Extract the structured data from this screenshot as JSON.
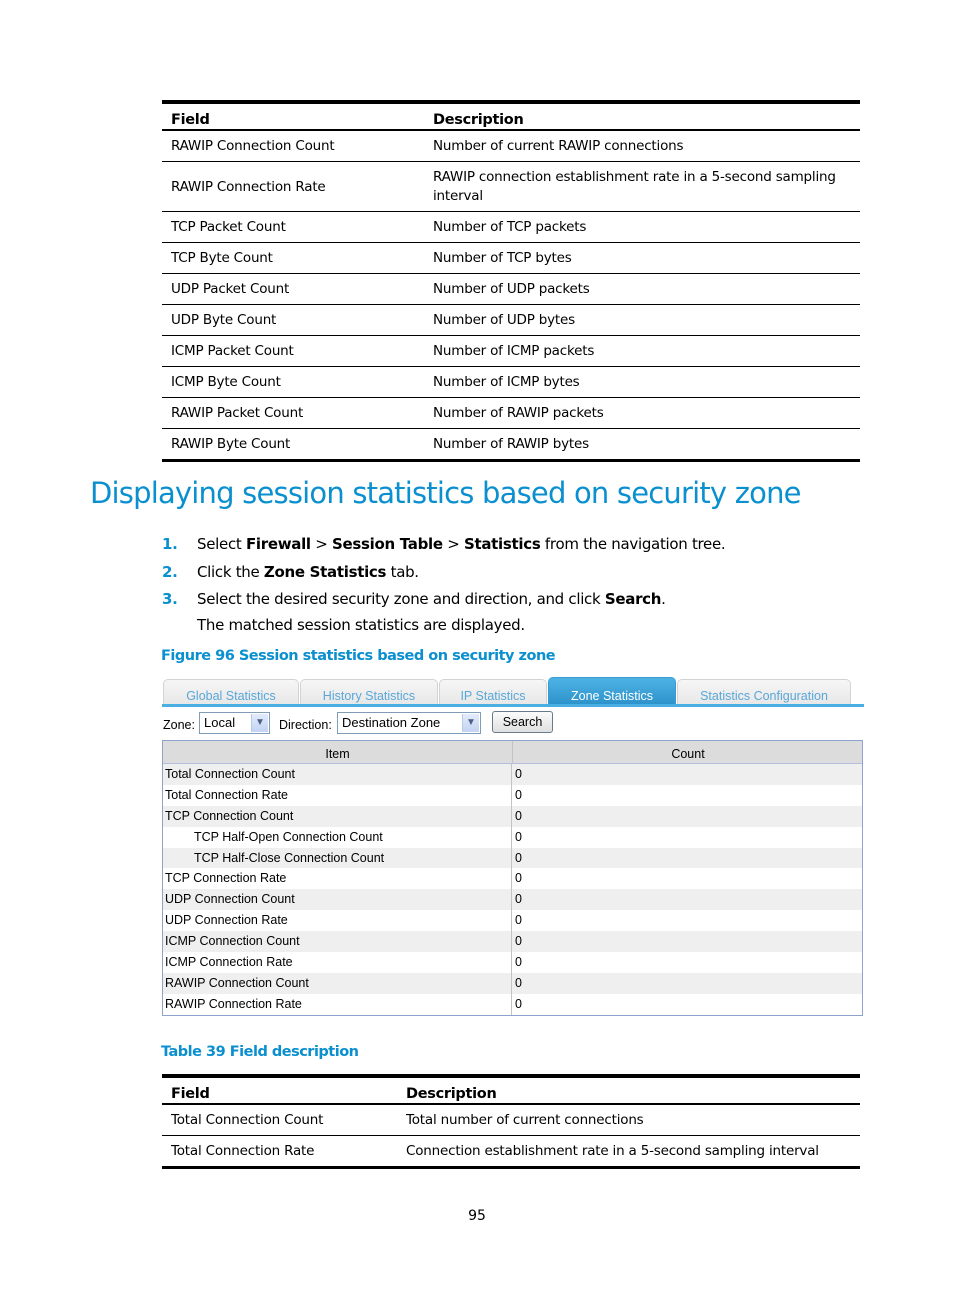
{
  "table_top": {
    "headers": [
      "Field",
      "Description"
    ],
    "rows": [
      {
        "field": "RAWIP Connection Count",
        "desc": "Number of current RAWIP connections"
      },
      {
        "field": "RAWIP Connection Rate",
        "desc": "RAWIP connection establishment rate in a 5-second sampling interval"
      },
      {
        "field": "TCP Packet Count",
        "desc": "Number of TCP packets"
      },
      {
        "field": "TCP Byte Count",
        "desc": "Number of TCP bytes"
      },
      {
        "field": "UDP Packet Count",
        "desc": "Number of UDP packets"
      },
      {
        "field": "UDP Byte Count",
        "desc": "Number of UDP bytes"
      },
      {
        "field": "ICMP Packet Count",
        "desc": "Number of ICMP packets"
      },
      {
        "field": "ICMP Byte Count",
        "desc": "Number of ICMP bytes"
      },
      {
        "field": "RAWIP Packet Count",
        "desc": "Number of RAWIP packets"
      },
      {
        "field": "RAWIP Byte Count",
        "desc": "Number of RAWIP bytes"
      }
    ]
  },
  "section": {
    "title": "Displaying session statistics based on security zone",
    "steps": [
      {
        "num": "1.",
        "parts": [
          [
            "Select ",
            false
          ],
          [
            "Firewall",
            true
          ],
          [
            " > ",
            false
          ],
          [
            "Session Table",
            true
          ],
          [
            " > ",
            false
          ],
          [
            "Statistics",
            true
          ],
          [
            " from the navigation tree.",
            false
          ]
        ]
      },
      {
        "num": "2.",
        "parts": [
          [
            "Click the ",
            false
          ],
          [
            "Zone Statistics",
            true
          ],
          [
            " tab.",
            false
          ]
        ]
      },
      {
        "num": "3.",
        "parts": [
          [
            "Select the desired security zone and direction, and click ",
            false
          ],
          [
            "Search",
            true
          ],
          [
            ".",
            false
          ]
        ]
      }
    ],
    "note": "The matched session statistics are displayed.",
    "figure_caption": "Figure 96 Session statistics based on security zone"
  },
  "ui": {
    "tabs": [
      {
        "label": "Global Statistics",
        "active": false
      },
      {
        "label": "History Statistics",
        "active": false
      },
      {
        "label": "IP Statistics",
        "active": false
      },
      {
        "label": "Zone Statistics",
        "active": true
      },
      {
        "label": "Statistics Configuration",
        "active": false
      }
    ],
    "zone_label": "Zone:",
    "zone_value": "Local",
    "direction_label": "Direction:",
    "direction_value": "Destination Zone",
    "search_label": "Search",
    "grid_headers": {
      "item": "Item",
      "count": "Count"
    },
    "grid_rows": [
      {
        "item": "Total Connection Count",
        "count": "0",
        "indent": false
      },
      {
        "item": "Total Connection Rate",
        "count": "0",
        "indent": false
      },
      {
        "item": "TCP Connection Count",
        "count": "0",
        "indent": false
      },
      {
        "item": "TCP Half-Open Connection Count",
        "count": "0",
        "indent": true
      },
      {
        "item": "TCP Half-Close Connection Count",
        "count": "0",
        "indent": true
      },
      {
        "item": "TCP Connection Rate",
        "count": "0",
        "indent": false
      },
      {
        "item": "UDP Connection Count",
        "count": "0",
        "indent": false
      },
      {
        "item": "UDP Connection Rate",
        "count": "0",
        "indent": false
      },
      {
        "item": "ICMP Connection Count",
        "count": "0",
        "indent": false
      },
      {
        "item": "ICMP Connection Rate",
        "count": "0",
        "indent": false
      },
      {
        "item": "RAWIP Connection Count",
        "count": "0",
        "indent": false
      },
      {
        "item": "RAWIP Connection Rate",
        "count": "0",
        "indent": false
      }
    ]
  },
  "table39": {
    "caption": "Table 39 Field description",
    "headers": [
      "Field",
      "Description"
    ],
    "rows": [
      {
        "field": "Total Connection Count",
        "desc": "Total number of current connections"
      },
      {
        "field": "Total Connection Rate",
        "desc": "Connection establishment rate in a 5-second sampling interval"
      }
    ]
  },
  "page_number": "95"
}
